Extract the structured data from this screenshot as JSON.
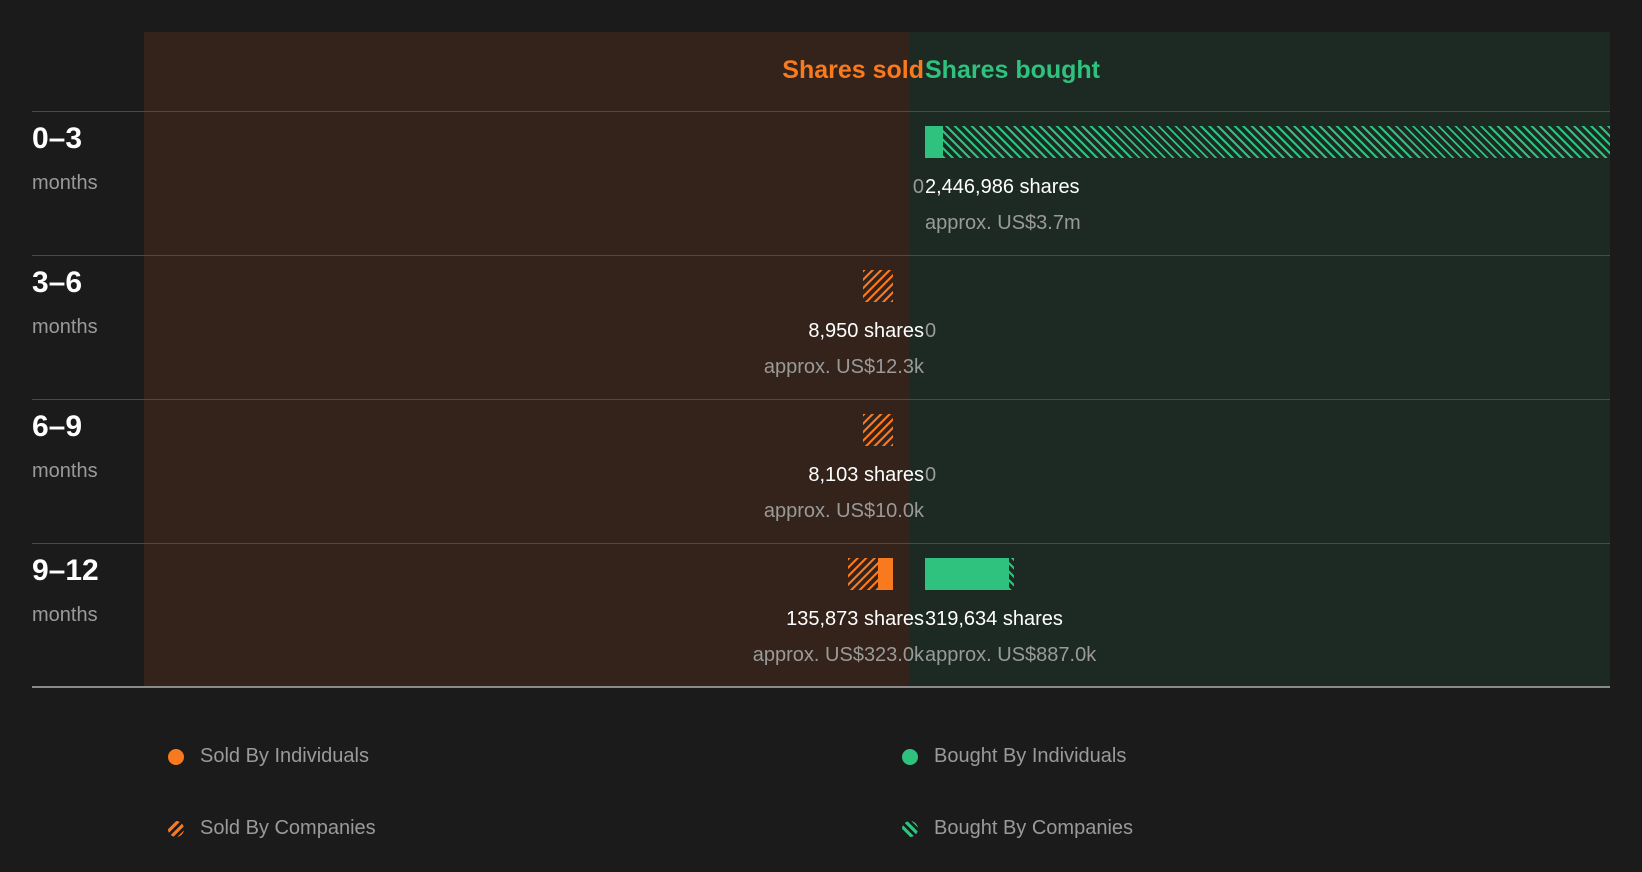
{
  "header": {
    "sold_label": "Shares sold",
    "bought_label": "Shares bought"
  },
  "chart_data": {
    "type": "bar",
    "categories": [
      "0–3",
      "3–6",
      "6–9",
      "9–12"
    ],
    "unit_label": "months",
    "series": [
      {
        "name": "Sold By Individuals",
        "side": "sold",
        "values": [
          0,
          0,
          0,
          45000
        ]
      },
      {
        "name": "Sold By Companies",
        "side": "sold",
        "values": [
          0,
          8950,
          8103,
          90873
        ]
      },
      {
        "name": "Bought By Individuals",
        "side": "bought",
        "values": [
          60000,
          0,
          0,
          300000
        ]
      },
      {
        "name": "Bought By Companies",
        "side": "bought",
        "values": [
          2386986,
          0,
          0,
          19634
        ]
      }
    ],
    "totals": {
      "sold": [
        0,
        8950,
        8103,
        135873
      ],
      "bought": [
        2446986,
        0,
        0,
        319634
      ]
    },
    "max_value": 2446986
  },
  "rows": [
    {
      "period": "0–3",
      "unit": "months",
      "sold_shares": "",
      "sold_approx": "",
      "sold_zero": "0",
      "bought_shares": "2,446,986 shares",
      "bought_approx": "approx. US$3.7m",
      "bought_zero": ""
    },
    {
      "period": "3–6",
      "unit": "months",
      "sold_shares": "8,950 shares",
      "sold_approx": "approx. US$12.3k",
      "sold_zero": "",
      "bought_shares": "",
      "bought_approx": "",
      "bought_zero": "0"
    },
    {
      "period": "6–9",
      "unit": "months",
      "sold_shares": "8,103 shares",
      "sold_approx": "approx. US$10.0k",
      "sold_zero": "",
      "bought_shares": "",
      "bought_approx": "",
      "bought_zero": "0"
    },
    {
      "period": "9–12",
      "unit": "months",
      "sold_shares": "135,873 shares",
      "sold_approx": "approx. US$323.0k",
      "sold_zero": "",
      "bought_shares": "319,634 shares",
      "bought_approx": "approx. US$887.0k",
      "bought_zero": ""
    }
  ],
  "legend": {
    "sold_individuals": "Sold By Individuals",
    "sold_companies": "Sold By Companies",
    "bought_individuals": "Bought By Individuals",
    "bought_companies": "Bought By Companies"
  },
  "colors": {
    "sold": "#f97a1e",
    "bought": "#2ec27e",
    "background": "#1b1b1b",
    "sold_panel": "#33231b",
    "bought_panel": "#1d2a24"
  }
}
